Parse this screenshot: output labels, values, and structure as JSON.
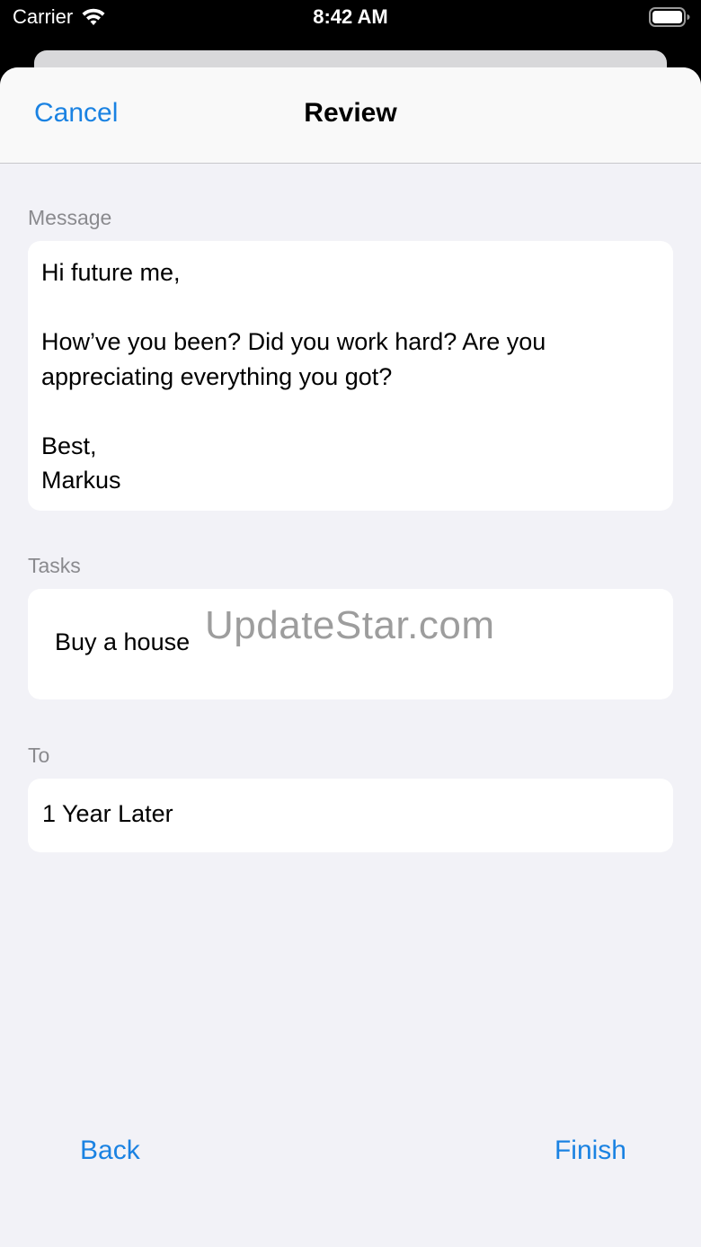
{
  "status_bar": {
    "carrier": "Carrier",
    "time": "8:42 AM"
  },
  "nav": {
    "cancel_label": "Cancel",
    "title": "Review"
  },
  "message_section": {
    "label": "Message",
    "text": "Hi future me,\n\nHow’ve you been? Did you work hard? Are you appreciating everything you got?\n\nBest,\nMarkus"
  },
  "tasks_section": {
    "label": "Tasks",
    "items": [
      "Buy a house"
    ],
    "watermark": "UpdateStar.com"
  },
  "to_section": {
    "label": "To",
    "value": "1 Year Later"
  },
  "footer": {
    "back_label": "Back",
    "finish_label": "Finish"
  },
  "colors": {
    "accent": "#1a82e2",
    "background": "#f2f2f7",
    "card": "#ffffff",
    "section_label": "#8a8a8e"
  },
  "icons": [
    "wifi-icon",
    "battery-icon"
  ]
}
